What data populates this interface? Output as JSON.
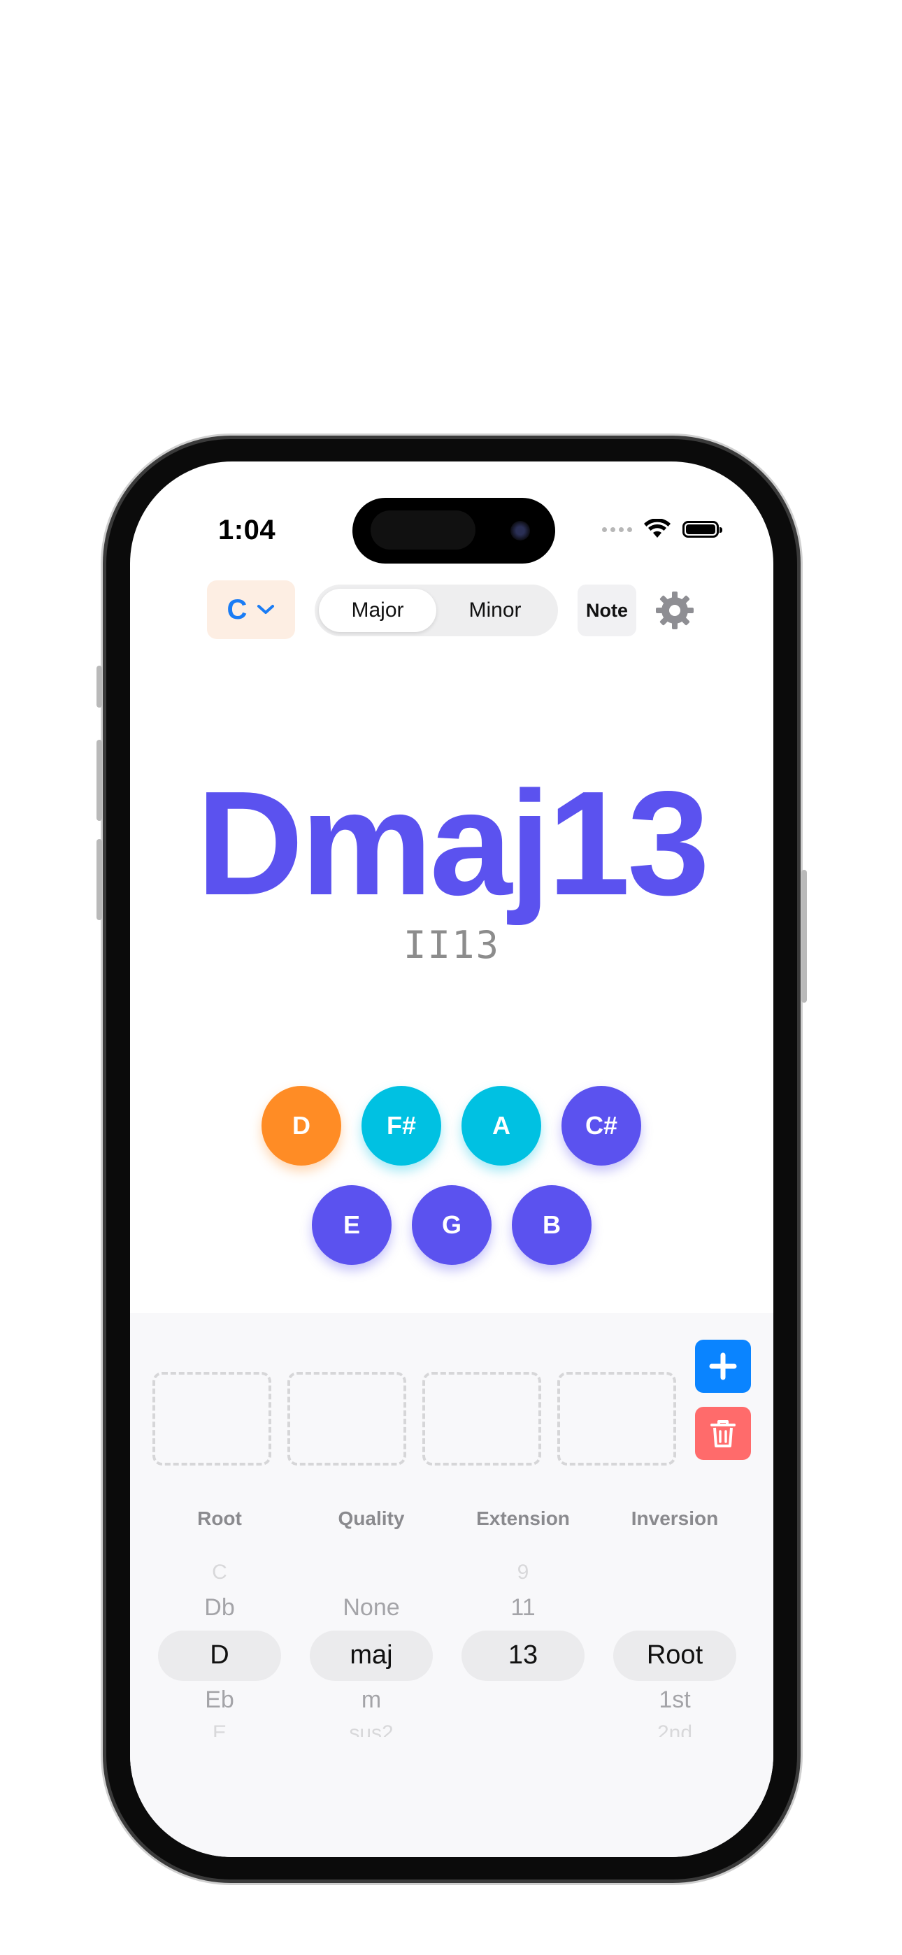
{
  "status_bar": {
    "time": "1:04"
  },
  "toolbar": {
    "key_value": "C",
    "mode_options": [
      "Major",
      "Minor"
    ],
    "mode_selected": "Major",
    "note_label": "Note"
  },
  "chord": {
    "name": "Dmaj13",
    "roman_numeral": "II13"
  },
  "chord_notes": [
    {
      "name": "D",
      "role": "root",
      "color": "#ff8c25"
    },
    {
      "name": "F#",
      "role": "chord-tone",
      "color": "#00c1e2"
    },
    {
      "name": "A",
      "role": "chord-tone",
      "color": "#00c1e2"
    },
    {
      "name": "C#",
      "role": "extension",
      "color": "#5b52ef"
    },
    {
      "name": "E",
      "role": "extension",
      "color": "#5b52ef"
    },
    {
      "name": "G",
      "role": "extension",
      "color": "#5b52ef"
    },
    {
      "name": "B",
      "role": "extension",
      "color": "#5b52ef"
    }
  ],
  "progression_slots": [
    "",
    "",
    "",
    ""
  ],
  "picker": {
    "columns": [
      {
        "label": "Root",
        "above2": "C",
        "above1": "Db",
        "selected": "D",
        "below1": "Eb",
        "below2": "E"
      },
      {
        "label": "Quality",
        "above2": "",
        "above1": "None",
        "selected": "maj",
        "below1": "m",
        "below2": "sus2"
      },
      {
        "label": "Extension",
        "above2": "9",
        "above1": "11",
        "selected": "13",
        "below1": "",
        "below2": ""
      },
      {
        "label": "Inversion",
        "above2": "",
        "above1": "",
        "selected": "Root",
        "below1": "1st",
        "below2": "2nd"
      }
    ]
  },
  "colors": {
    "accent_violet": "#5b52ef",
    "accent_blue": "#0a84ff",
    "delete_red": "#ff6b6b",
    "root_orange": "#ff8c25",
    "tone_cyan": "#00c1e2"
  }
}
